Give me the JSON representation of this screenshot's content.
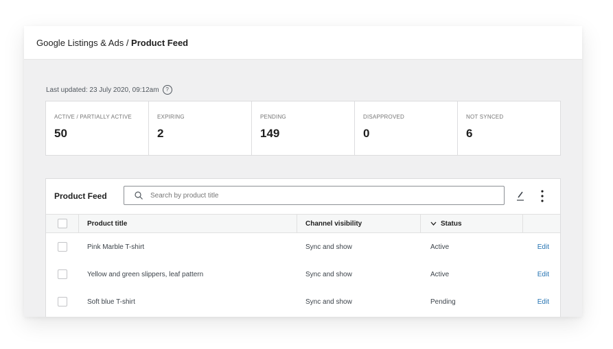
{
  "header": {
    "breadcrumb_parent": "Google Listings & Ads",
    "breadcrumb_sep": " / ",
    "breadcrumb_current": "Product Feed"
  },
  "last_updated": "Last updated: 23 July 2020, 09:12am",
  "help_glyph": "?",
  "summary": [
    {
      "label": "Active / Partially Active",
      "value": "50"
    },
    {
      "label": "Expiring",
      "value": "2"
    },
    {
      "label": "Pending",
      "value": "149"
    },
    {
      "label": "Disapproved",
      "value": "0"
    },
    {
      "label": "Not Synced",
      "value": "6"
    }
  ],
  "feed": {
    "title": "Product Feed",
    "search_placeholder": "Search by product title",
    "columns": {
      "title": "Product title",
      "visibility": "Channel visibility",
      "status": "Status"
    },
    "rows": [
      {
        "title": "Pink Marble T-shirt",
        "visibility": "Sync and show",
        "status": "Active",
        "action": "Edit"
      },
      {
        "title": "Yellow and green slippers, leaf pattern",
        "visibility": "Sync and show",
        "status": "Active",
        "action": "Edit"
      },
      {
        "title": "Soft blue T-shirt",
        "visibility": "Sync and show",
        "status": "Pending",
        "action": "Edit"
      }
    ]
  },
  "colors": {
    "accent_link": "#2271b1",
    "page_bg": "#f0f0f1",
    "text": "#1e1e1e"
  },
  "icons": [
    "help-icon",
    "search-icon",
    "pencil-icon",
    "more-vertical-icon",
    "chevron-down-icon"
  ]
}
